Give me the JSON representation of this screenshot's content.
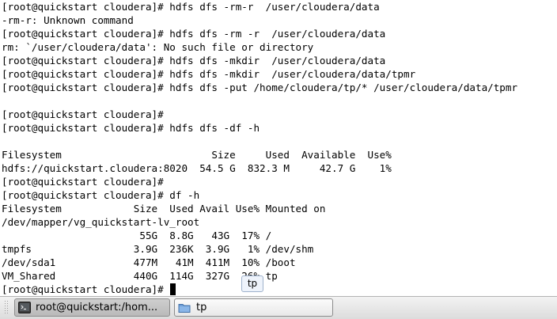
{
  "terminal": {
    "lines": [
      "[root@quickstart cloudera]# hdfs dfs -rm-r  /user/cloudera/data",
      "-rm-r: Unknown command",
      "[root@quickstart cloudera]# hdfs dfs -rm -r  /user/cloudera/data",
      "rm: `/user/cloudera/data': No such file or directory",
      "[root@quickstart cloudera]# hdfs dfs -mkdir  /user/cloudera/data",
      "[root@quickstart cloudera]# hdfs dfs -mkdir  /user/cloudera/data/tpmr",
      "[root@quickstart cloudera]# hdfs dfs -put /home/cloudera/tp/* /user/cloudera/data/tpmr",
      "",
      "[root@quickstart cloudera]#",
      "[root@quickstart cloudera]# hdfs dfs -df -h",
      "",
      "Filesystem                         Size     Used  Available  Use%",
      "hdfs://quickstart.cloudera:8020  54.5 G  832.3 M     42.7 G    1%",
      "[root@quickstart cloudera]#",
      "[root@quickstart cloudera]# df -h",
      "Filesystem            Size  Used Avail Use% Mounted on",
      "/dev/mapper/vg_quickstart-lv_root",
      "                       55G  8.8G   43G  17% /",
      "tmpfs                 3.9G  236K  3.9G   1% /dev/shm",
      "/dev/sda1             477M   41M  411M  10% /boot",
      "VM_Shared             440G  114G  327G  26% tp"
    ],
    "prompt": "[root@quickstart cloudera]# "
  },
  "tooltip": {
    "text": "tp"
  },
  "taskbar": {
    "tasks": [
      {
        "label": "root@quickstart:/hom...",
        "icon": "terminal-icon",
        "active": true
      },
      {
        "label": "tp",
        "icon": "folder-icon",
        "active": false
      }
    ]
  }
}
